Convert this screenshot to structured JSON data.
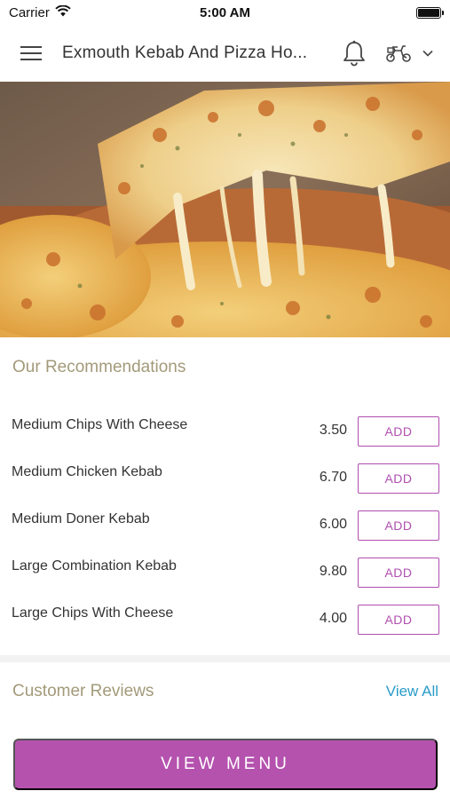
{
  "status": {
    "carrier": "Carrier",
    "time": "5:00 AM"
  },
  "header": {
    "title": "Exmouth Kebab And Pizza Ho...",
    "icons": [
      "menu-icon",
      "bell-icon",
      "scooter-icon",
      "chevron-down-icon"
    ]
  },
  "recommendations": {
    "title": "Our Recommendations",
    "add_label": "ADD",
    "items": [
      {
        "name": "Medium Chips With Cheese",
        "price": "3.50"
      },
      {
        "name": "Medium Chicken Kebab",
        "price": "6.70"
      },
      {
        "name": "Medium Doner Kebab",
        "price": "6.00"
      },
      {
        "name": "Large Combination Kebab",
        "price": "9.80"
      },
      {
        "name": "Large Chips With Cheese",
        "price": "4.00"
      }
    ]
  },
  "reviews": {
    "title": "Customer Reviews",
    "view_all": "View All"
  },
  "footer": {
    "view_menu": "VIEW MENU"
  },
  "colors": {
    "accent": "#b452ae",
    "section_title": "#a39a7a",
    "link": "#2a9cc8"
  }
}
